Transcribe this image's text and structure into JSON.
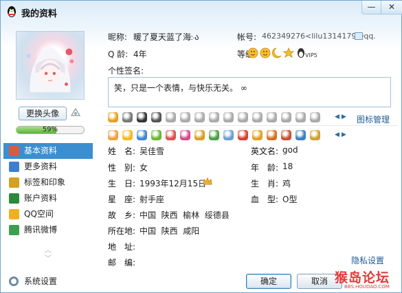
{
  "window": {
    "title": "我的资料",
    "minimize": "—",
    "close": "✕"
  },
  "left": {
    "change_avatar": "更换头像",
    "progress_percent": 59,
    "progress_label": "59%",
    "nav": [
      {
        "label": "基本资料",
        "icon": "profile-card-icon",
        "color": "#e05a3a"
      },
      {
        "label": "更多资料",
        "icon": "more-info-icon",
        "color": "#3a7fd0"
      },
      {
        "label": "标签和印象",
        "icon": "tag-icon",
        "color": "#d6a020"
      },
      {
        "label": "账户资料",
        "icon": "account-icon",
        "color": "#2a8a3a"
      },
      {
        "label": "QQ空间",
        "icon": "star-space-icon",
        "color": "#f0b020"
      },
      {
        "label": "腾讯微博",
        "icon": "weibo-icon",
        "color": "#3aa050"
      }
    ],
    "settings_label": "系统设置"
  },
  "main": {
    "nickname_label": "昵称:",
    "nickname": "暖了夏天蓝了海჻ა",
    "account_label": "帐号:",
    "account": "462349276<lilu1314179@qq.",
    "age_label": "Q 龄:",
    "age": "4年",
    "level_label": "等级:",
    "signature_label": "个性签名:",
    "signature": "笑，只是一个表情，与快乐无关。  ∞",
    "icon_manage": "图标管理",
    "accent": "#3b8ed0"
  },
  "info": {
    "name_label": "姓　名:",
    "name": "吴佳雪",
    "english_name_label": "英文名:",
    "english_name": "god",
    "gender_label": "性　别:",
    "gender": "女",
    "age_label": "年　龄:",
    "age": "18",
    "birthday_label": "生　日:",
    "birthday": "1993年12月15日",
    "zodiac_label": "生　肖:",
    "zodiac": "鸡",
    "constellation_label": "星　座:",
    "constellation": "射手座",
    "blood_label": "血　型:",
    "blood": "O型",
    "hometown_label": "故　乡:",
    "hometown": "中国  陕西  榆林  绥德县",
    "location_label": "所在地:",
    "location": "中国  陕西  咸阳",
    "address_label": "地　址:",
    "address": "",
    "postal_label": "邮　编:",
    "postal": ""
  },
  "footer": {
    "privacy": "隐私设置",
    "ok": "确定",
    "cancel": "取消"
  },
  "watermark": {
    "main": "猴岛论坛",
    "sub": "BBS.HOUDAO.COM"
  }
}
